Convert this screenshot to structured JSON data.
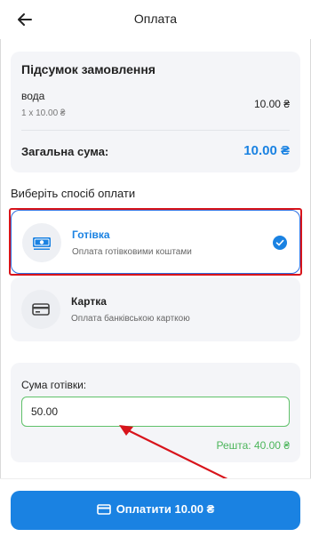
{
  "header": {
    "title": "Оплата",
    "back_icon": "arrow-left-icon"
  },
  "summary": {
    "title": "Підсумок замовлення",
    "item_name": "вода",
    "item_qty": "1 x 10.00 ₴",
    "item_price": "10.00 ₴",
    "total_label": "Загальна сума:",
    "total_value": "10.00 ₴"
  },
  "payment": {
    "label": "Виберіть спосіб оплати",
    "options": [
      {
        "name": "Готівка",
        "description": "Оплата готівковими коштами",
        "icon": "cash-icon",
        "selected": true
      },
      {
        "name": "Картка",
        "description": "Оплата банківською карткою",
        "icon": "card-icon",
        "selected": false
      }
    ]
  },
  "cash": {
    "label": "Сума готівки:",
    "value": "50.00",
    "change": "Решта: 40.00 ₴"
  },
  "pay_button": {
    "label": "Оплатити 10.00 ₴",
    "icon": "card-icon"
  },
  "colors": {
    "accent": "#1a82e2",
    "success": "#4bb55a",
    "highlight": "#d8141b"
  }
}
